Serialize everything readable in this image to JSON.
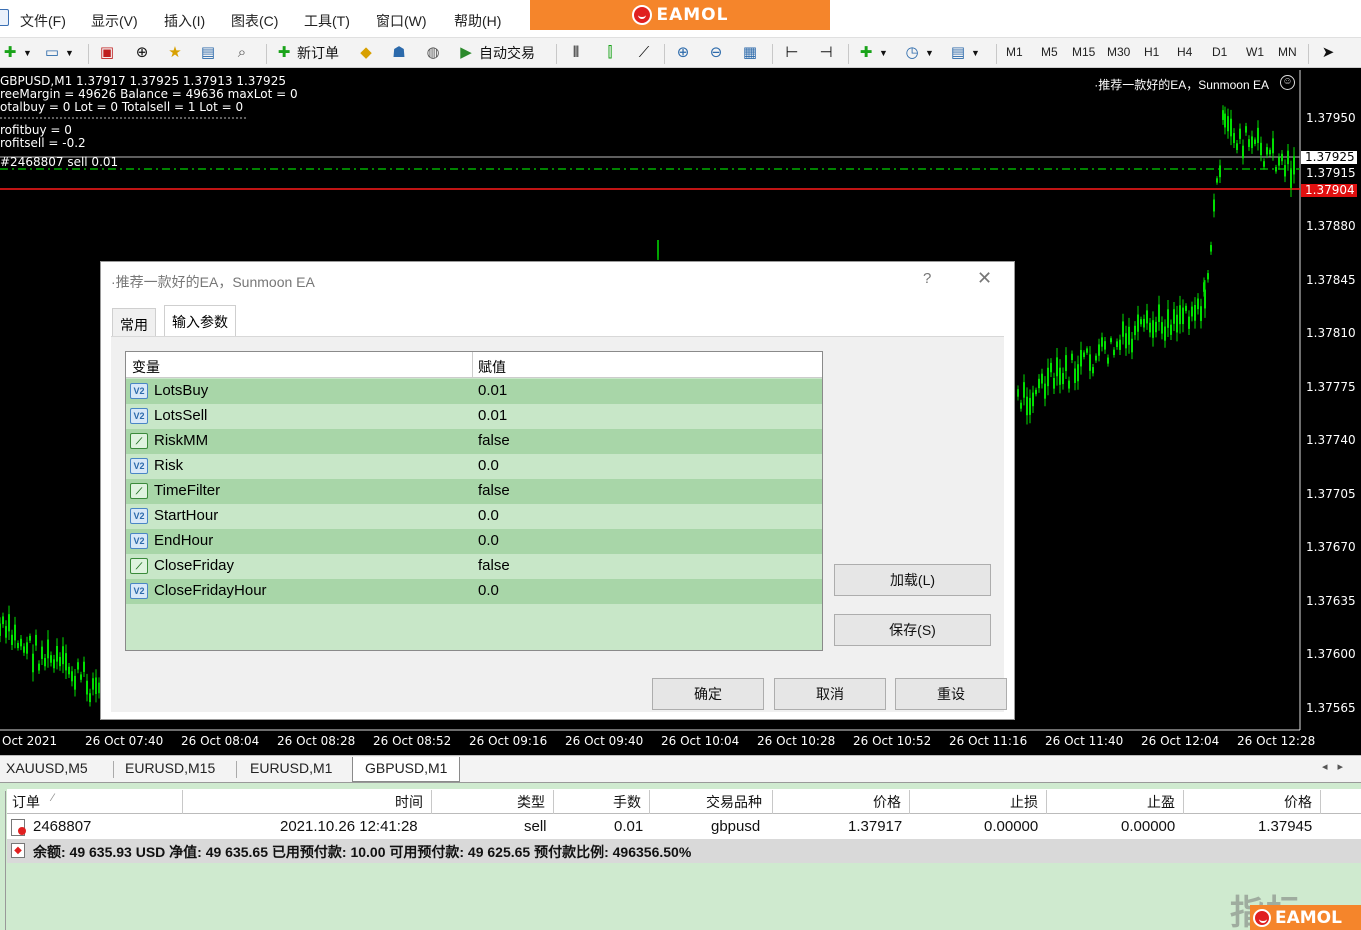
{
  "menu": [
    "文件(F)",
    "显示(V)",
    "插入(I)",
    "图表(C)",
    "工具(T)",
    "窗口(W)",
    "帮助(H)"
  ],
  "brand": "EAMOL",
  "toolbar": {
    "new_order_label": "新订单",
    "auto_trade_label": "自动交易",
    "timeframes": [
      "M1",
      "M5",
      "M15",
      "M30",
      "H1",
      "H4",
      "D1",
      "W1",
      "MN"
    ]
  },
  "chart": {
    "info_lines": [
      "GBPUSD,M1  1.37917 1.37925 1.37913 1.37925",
      "reeMargin = 49626  Balance = 49636  maxLot = 0",
      "otalbuy = 0  Lot = 0  Totalsell = 1  Lot = 0",
      "rofitbuy = 0",
      "rofitsell = -0.2",
      "#2468807 sell 0.01"
    ],
    "ea_name": "·推荐一款好的EA，Sunmoon EA",
    "price_ticks": [
      "1.37950",
      "1.37880",
      "1.37845",
      "1.37810",
      "1.37775",
      "1.37740",
      "1.37705",
      "1.37670",
      "1.37635",
      "1.37600",
      "1.37565"
    ],
    "price_tags": {
      "bid": "1.37925",
      "line": "1.37915",
      "sell": "1.37904"
    },
    "time_ticks": [
      "Oct 2021",
      "26 Oct 07:40",
      "26 Oct 08:04",
      "26 Oct 08:28",
      "26 Oct 08:52",
      "26 Oct 09:16",
      "26 Oct 09:40",
      "26 Oct 10:04",
      "26 Oct 10:28",
      "26 Oct 10:52",
      "26 Oct 11:16",
      "26 Oct 11:40",
      "26 Oct 12:04",
      "26 Oct 12:28"
    ],
    "colors": {
      "candle": "#00e000",
      "bid_line": "#bbbbbb",
      "sell_line": "#ff1a1a",
      "order_line": "#00b000"
    }
  },
  "dialog": {
    "title": "·推荐一款好的EA，Sunmoon EA",
    "help": "?",
    "tabs": [
      "常用",
      "输入参数"
    ],
    "col_variable": "变量",
    "col_value": "赋值",
    "params": [
      {
        "name": "LotsBuy",
        "value": "0.01",
        "icon": "number-param-icon"
      },
      {
        "name": "LotsSell",
        "value": "0.01",
        "icon": "number-param-icon"
      },
      {
        "name": "RiskMM",
        "value": "false",
        "icon": "bool-param-icon"
      },
      {
        "name": "Risk",
        "value": "0.0",
        "icon": "number-param-icon"
      },
      {
        "name": "TimeFilter",
        "value": "false",
        "icon": "bool-param-icon"
      },
      {
        "name": "StartHour",
        "value": "0.0",
        "icon": "number-param-icon"
      },
      {
        "name": "EndHour",
        "value": "0.0",
        "icon": "number-param-icon"
      },
      {
        "name": "CloseFriday",
        "value": "false",
        "icon": "bool-param-icon"
      },
      {
        "name": "CloseFridayHour",
        "value": "0.0",
        "icon": "number-param-icon"
      }
    ],
    "load_label": "加载(L)",
    "save_label": "保存(S)",
    "ok_label": "确定",
    "cancel_label": "取消",
    "reset_label": "重设"
  },
  "chart_tabs": [
    "XAUUSD,M5",
    "EURUSD,M15",
    "EURUSD,M1",
    "GBPUSD,M1"
  ],
  "terminal": {
    "headers": [
      "订单",
      "时间",
      "类型",
      "手数",
      "交易品种",
      "价格",
      "止损",
      "止盈",
      "价格"
    ],
    "order": {
      "id": "2468807",
      "time": "2021.10.26 12:41:28",
      "type": "sell",
      "lots": "0.01",
      "symbol": "gbpusd",
      "price": "1.37917",
      "sl": "0.00000",
      "tp": "0.00000",
      "current": "1.37945"
    },
    "balance": "余额: 49 635.93 USD  净值: 49 635.65  已用预付款: 10.00  可用预付款: 49 625.65  预付款比例: 496356.50%"
  },
  "watermark": "指标",
  "badge": "EAMOL"
}
